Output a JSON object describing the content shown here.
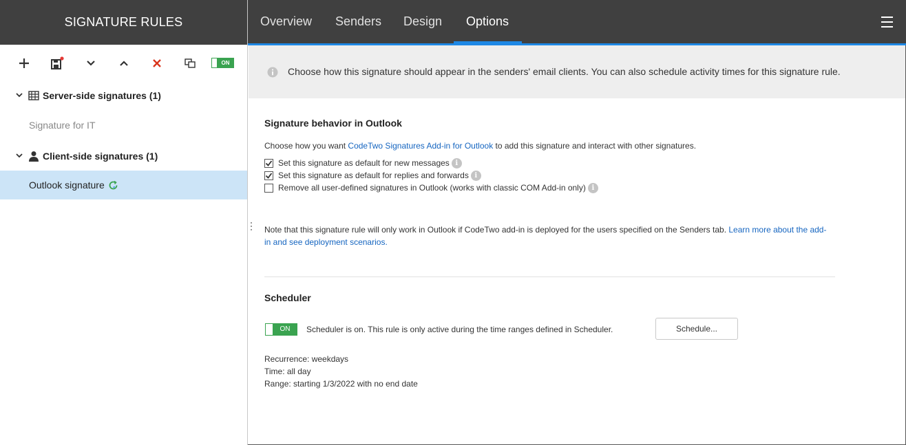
{
  "sidebar": {
    "title": "SIGNATURE RULES",
    "toolbar": {
      "add_icon": "plus-icon",
      "save_icon": "save-icon",
      "move_down_icon": "chevron-down-icon",
      "move_up_icon": "chevron-up-icon",
      "delete_icon": "close-icon",
      "copy_icon": "copy-icon",
      "toggle_label": "ON"
    },
    "groups": [
      {
        "label": "Server-side signatures (1)",
        "icon": "server-icon",
        "items": [
          {
            "label": "Signature for IT"
          }
        ]
      },
      {
        "label": "Client-side signatures (1)",
        "icon": "user-icon",
        "items": [
          {
            "label": "Outlook signature",
            "icon": "sync-icon",
            "selected": true
          }
        ]
      }
    ]
  },
  "nav": {
    "tabs": [
      {
        "label": "Overview"
      },
      {
        "label": "Senders"
      },
      {
        "label": "Design"
      },
      {
        "label": "Options",
        "active": true
      }
    ],
    "menu_icon": "hamburger-icon"
  },
  "banner": {
    "text": "Choose how this signature should appear in the senders' email clients. You can also schedule activity times for this signature rule."
  },
  "behavior": {
    "title": "Signature behavior in Outlook",
    "intro_prefix": "Choose how you want ",
    "intro_link": "CodeTwo Signatures Add-in for Outlook",
    "intro_suffix": " to add this signature and interact with other signatures.",
    "options": [
      {
        "label": "Set this signature as default for new messages",
        "checked": true
      },
      {
        "label": "Set this signature as default for replies and forwards",
        "checked": true
      },
      {
        "label": "Remove all user-defined signatures in Outlook (works with classic COM Add-in only)",
        "checked": false
      }
    ],
    "note_text": "Note that this signature rule will only work in Outlook if CodeTwo add-in is deployed for the users specified on the Senders tab. ",
    "note_link_line1": "Learn more about the add-",
    "note_link_line2": "in and see deployment scenarios."
  },
  "scheduler": {
    "title": "Scheduler",
    "toggle_label": "ON",
    "status_text": "Scheduler is on. This rule is only active during the time ranges defined in Scheduler.",
    "button_label": "Schedule...",
    "recurrence": "Recurrence: weekdays",
    "time": "Time: all day",
    "range": "Range: starting 1/3/2022 with no end date"
  },
  "colors": {
    "header_bg": "#404040",
    "accent_blue": "#1e88e5",
    "toggle_green": "#3aa350",
    "selected_row": "#cce4f7",
    "delete_red": "#d9341c"
  }
}
